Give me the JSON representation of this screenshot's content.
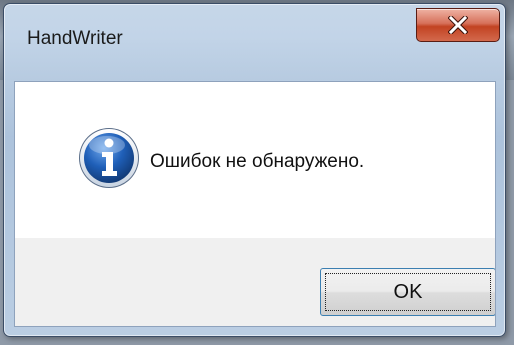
{
  "window": {
    "title": "HandWriter",
    "close_icon": "close-icon"
  },
  "message": {
    "icon": "info-icon",
    "text": "Ошибок не обнаружено."
  },
  "buttons": {
    "ok_label": "OK"
  },
  "colors": {
    "close_button": "#c24322",
    "info_icon": "#1f5fb8",
    "button_focus_border": "#3c7fb1"
  }
}
